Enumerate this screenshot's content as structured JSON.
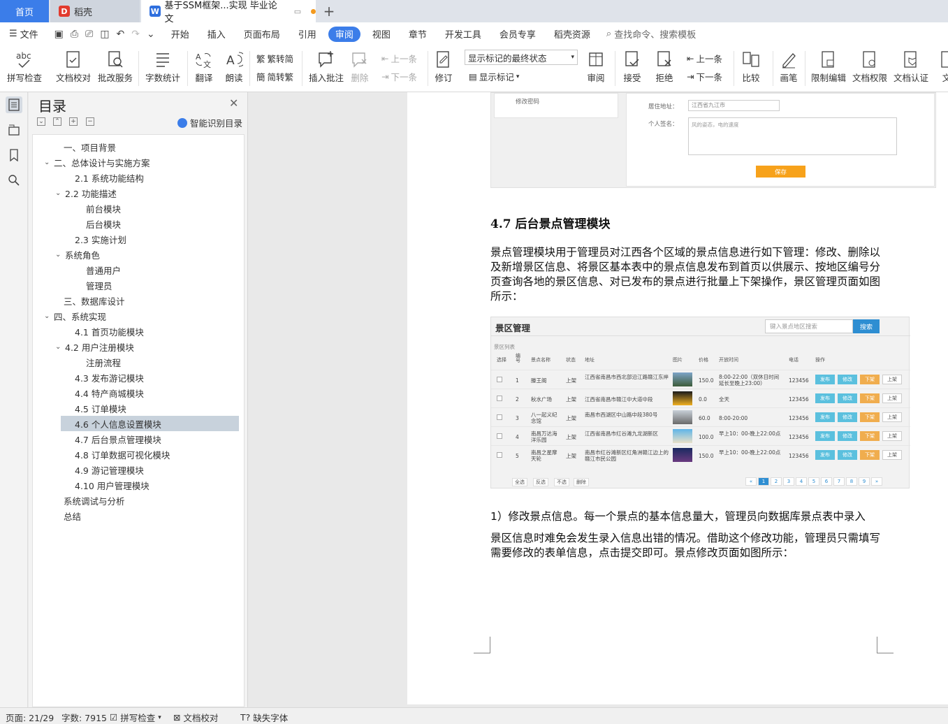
{
  "tabs": {
    "home": "首页",
    "daoke": "稻壳",
    "doc_title": "基于SSM框架...实现 毕业论文"
  },
  "menu": {
    "file": "文件",
    "items": [
      "开始",
      "插入",
      "页面布局",
      "引用",
      "审阅",
      "视图",
      "章节",
      "开发工具",
      "会员专享",
      "稻壳资源"
    ],
    "active": "审阅",
    "search_placeholder": "查找命令、搜索模板"
  },
  "toolbar": {
    "spell_check": "拼写检查",
    "doc_proof": "文档校对",
    "batch_service": "批改服务",
    "word_count": "字数统计",
    "translate": "翻译",
    "read_aloud": "朗读",
    "trad_to_simp": "繁转简",
    "simp_to_trad": "简转繁",
    "insert_comment": "插入批注",
    "delete": "删除",
    "prev_comment": "上一条",
    "next_comment": "下一条",
    "revise": "修订",
    "mark_state": "显示标记的最终状态",
    "show_marks": "显示标记",
    "review": "审阅",
    "accept": "接受",
    "reject": "拒绝",
    "prev": "上一条",
    "next": "下一条",
    "compare": "比较",
    "pen": "画笔",
    "restrict_edit": "限制编辑",
    "doc_rights": "文档权限",
    "doc_cert": "文档认证",
    "overflow": "文"
  },
  "toc": {
    "title": "目录",
    "smart": "智能识别目录",
    "items": [
      {
        "label": "一、项目背景",
        "level": 0,
        "arrow": ""
      },
      {
        "label": "二、总体设计与实施方案",
        "level": 0,
        "arrow": "v"
      },
      {
        "label": "2.1  系统功能结构",
        "level": 1,
        "arrow": ""
      },
      {
        "label": "2.2  功能描述",
        "level": 1,
        "arrow": "v"
      },
      {
        "label": "前台模块",
        "level": 2,
        "arrow": ""
      },
      {
        "label": "后台模块",
        "level": 2,
        "arrow": ""
      },
      {
        "label": "2.3  实施计划",
        "level": 1,
        "arrow": ""
      },
      {
        "label": "系统角色",
        "level": 1,
        "arrow": "v"
      },
      {
        "label": "普通用户",
        "level": 2,
        "arrow": ""
      },
      {
        "label": "管理员",
        "level": 2,
        "arrow": ""
      },
      {
        "label": "三、数据库设计",
        "level": 0,
        "arrow": ""
      },
      {
        "label": "四、系统实现",
        "level": 0,
        "arrow": "v"
      },
      {
        "label": "4.1  首页功能模块",
        "level": 1,
        "arrow": ""
      },
      {
        "label": "4.2  用户注册模块",
        "level": 1,
        "arrow": "v"
      },
      {
        "label": "注册流程",
        "level": 2,
        "arrow": ""
      },
      {
        "label": "4.3  发布游记模块",
        "level": 1,
        "arrow": ""
      },
      {
        "label": "4.4  特产商城模块",
        "level": 1,
        "arrow": ""
      },
      {
        "label": "4.5  订单模块",
        "level": 1,
        "arrow": ""
      },
      {
        "label": "4.6  个人信息设置模块",
        "level": 1,
        "arrow": "",
        "selected": true
      },
      {
        "label": "4.7  后台景点管理模块",
        "level": 1,
        "arrow": ""
      },
      {
        "label": "4.8  订单数据可视化模块",
        "level": 1,
        "arrow": ""
      },
      {
        "label": "4.9  游记管理模块",
        "level": 1,
        "arrow": ""
      },
      {
        "label": "4.10  用户管理模块",
        "level": 1,
        "arrow": ""
      },
      {
        "label": "系统调试与分析",
        "level": 0,
        "arrow": ""
      },
      {
        "label": "总结",
        "level": 0,
        "arrow": ""
      }
    ]
  },
  "document": {
    "top_shot": {
      "change_password": "修改密码",
      "address_label": "居住地址：",
      "address_value": "江西省九江市",
      "sign_label": "个人签名：",
      "sign_value": "风的姿态，电的速度",
      "save": "保存"
    },
    "heading": "4.7  后台景点管理模块",
    "para1": "景点管理模块用于管理员对江西各个区域的景点信息进行如下管理：修改、删除以及新增景区信息、将景区基本表中的景点信息发布到首页以供展示、按地区编号分页查询各地的景区信息、对已发布的景点进行批量上下架操作，景区管理页面如图所示：",
    "para2_line1": "1）修改景点信息。每一个景点的基本信息量大，管理员向数据库景点表中录入",
    "para2_line2": "景区信息时难免会发生录入信息出错的情况。借助这个修改功能，管理员只需填写需要修改的表单信息，点击提交即可。景点修改页面如图所示："
  },
  "admin": {
    "title": "景区管理",
    "search_placeholder": "键入景点地区搜索",
    "search_btn": "搜索",
    "list_label": "景区列表",
    "headers": [
      "选择",
      "编号",
      "景点名称",
      "状态",
      "地址",
      "图片",
      "价格",
      "开放时间",
      "电话",
      "操作"
    ],
    "rows": [
      {
        "id": "1",
        "name": "滕王阁",
        "status": "上架",
        "addr": "江西省南昌市西北部沿江路赣江东岸",
        "price": "150.0",
        "time": "8:00-22:00（双休日时间延长至晚上23:00）",
        "phone": "123456"
      },
      {
        "id": "2",
        "name": "秋水广场",
        "status": "上架",
        "addr": "江西省南昌市赣江中大道中段",
        "price": "0.0",
        "time": "全天",
        "phone": "123456"
      },
      {
        "id": "3",
        "name": "八一起义纪念馆",
        "status": "上架",
        "addr": "南昌市西湖区中山路中段380号",
        "price": "60.0",
        "time": "8:00-20:00",
        "phone": "123456"
      },
      {
        "id": "4",
        "name": "南昌万达海洋乐园",
        "status": "上架",
        "addr": "江西省南昌市红谷滩九龙湖新区",
        "price": "100.0",
        "time": "早上10：00-晚上22:00点",
        "phone": "123456"
      },
      {
        "id": "5",
        "name": "南昌之星摩天轮",
        "status": "上架",
        "addr": "南昌市红谷滩新区红角洲赣江边上的赣江市民公园",
        "price": "150.0",
        "time": "早上10：00-晚上22:00点",
        "phone": "123456"
      }
    ],
    "actions": {
      "publish": "发布",
      "edit": "修改",
      "off": "下架",
      "on": "上架"
    },
    "footer": [
      "全选",
      "反选",
      "不选",
      "删除"
    ],
    "pages": [
      "«",
      "1",
      "2",
      "3",
      "4",
      "5",
      "6",
      "7",
      "8",
      "9",
      "»"
    ],
    "colors": {
      "publish": "#5bc0de",
      "edit": "#5bc0de",
      "off": "#f0ad4e"
    }
  },
  "status": {
    "page": "页面: 21/29",
    "words": "字数: 7915",
    "spell": "拼写检查",
    "proof": "文档校对",
    "missing_font": "缺失字体"
  }
}
